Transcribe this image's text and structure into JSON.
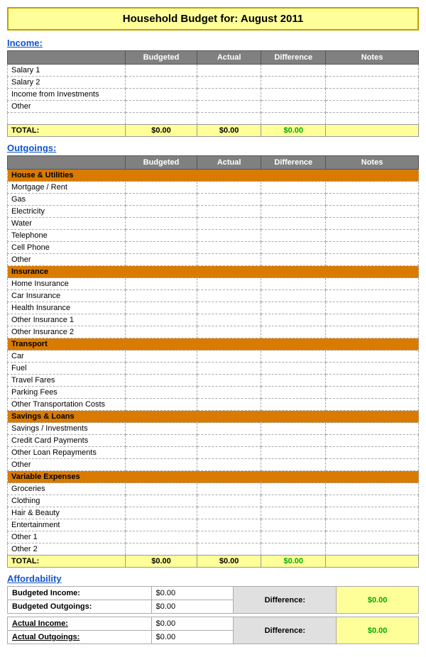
{
  "title": {
    "prefix": "Household Budget for:",
    "month": "  August 2011"
  },
  "income": {
    "section_label": "Income:",
    "columns": [
      "",
      "Budgeted",
      "Actual",
      "Difference",
      "Notes"
    ],
    "rows": [
      {
        "label": "Salary 1",
        "budgeted": "",
        "actual": "",
        "difference": "",
        "notes": ""
      },
      {
        "label": "Salary 2",
        "budgeted": "",
        "actual": "",
        "difference": "",
        "notes": ""
      },
      {
        "label": "Income from Investments",
        "budgeted": "",
        "actual": "",
        "difference": "",
        "notes": ""
      },
      {
        "label": "Other",
        "budgeted": "",
        "actual": "",
        "difference": "",
        "notes": ""
      }
    ],
    "total": {
      "label": "TOTAL:",
      "budgeted": "$0.00",
      "actual": "$0.00",
      "difference": "$0.00",
      "notes": ""
    }
  },
  "outgoings": {
    "section_label": "Outgoings:",
    "columns": [
      "",
      "Budgeted",
      "Actual",
      "Difference",
      "Notes"
    ],
    "categories": [
      {
        "header": "House & Utilities",
        "rows": [
          "Mortgage / Rent",
          "Gas",
          "Electricity",
          "Water",
          "Telephone",
          "Cell Phone",
          "Other"
        ]
      },
      {
        "header": "Insurance",
        "rows": [
          "Home Insurance",
          "Car Insurance",
          "Health Insurance",
          "Other Insurance 1",
          "Other Insurance 2"
        ]
      },
      {
        "header": "Transport",
        "rows": [
          "Car",
          "Fuel",
          "Travel Fares",
          "Parking Fees",
          "Other Transportation Costs"
        ]
      },
      {
        "header": "Savings & Loans",
        "rows": [
          "Savings / Investments",
          "Credit Card Payments",
          "Other Loan Repayments",
          "Other"
        ]
      },
      {
        "header": "Variable Expenses",
        "rows": [
          "Groceries",
          "Clothing",
          "Hair & Beauty",
          "Entertainment",
          "Other 1",
          "Other 2"
        ]
      }
    ],
    "total": {
      "label": "TOTAL:",
      "budgeted": "$0.00",
      "actual": "$0.00",
      "difference": "$0.00",
      "notes": ""
    }
  },
  "affordability": {
    "section_label": "Affordability",
    "block1": {
      "label1": "Budgeted Income:",
      "val1": "$0.00",
      "label2": "Budgeted Outgoings:",
      "val2": "$0.00",
      "diff_label": "Difference:",
      "diff_val": "$0.00"
    },
    "block2": {
      "label1": "Actual Income:",
      "val1": "$0.00",
      "label2": "Actual Outgoings:",
      "val2": "$0.00",
      "diff_label": "Difference:",
      "diff_val": "$0.00"
    }
  }
}
